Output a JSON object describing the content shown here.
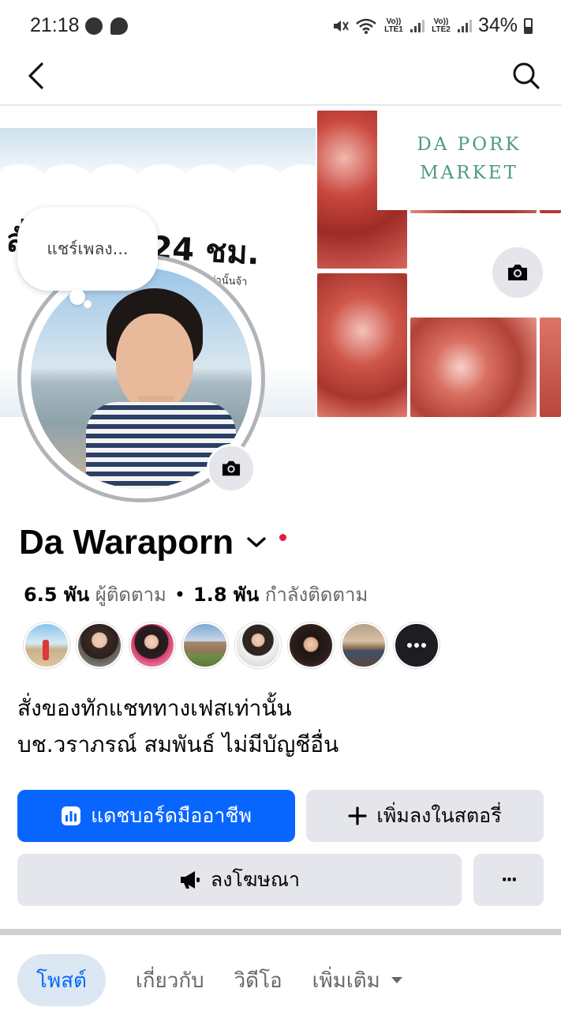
{
  "status_bar": {
    "time": "21:18",
    "battery": "34%",
    "sim1": "Vo)) LTE1",
    "sim2": "Vo)) LTE2"
  },
  "cover": {
    "headline": "สั่ง...แชท 24 ชม.",
    "subline": "...ธิ์ เท่านั้นจ้า",
    "brand_line1": "DA PORK",
    "brand_line2": "MARKET"
  },
  "note": {
    "text": "แชร์เพลง..."
  },
  "profile": {
    "name": "Da Waraporn",
    "followers_count": "6.5 พัน",
    "followers_label": "ผู้ติดตาม",
    "separator": "•",
    "following_count": "1.8 พัน",
    "following_label": "กำลังติดตาม",
    "bio_line1": "สั่งของทักแชททางเฟสเท่านั้น",
    "bio_line2": "บช.วราภรณ์ สมพันธ์ ไม่มีบัญชีอื่น"
  },
  "actions": {
    "dashboard": "แดชบอร์ดมืออาชีพ",
    "add_story": "เพิ่มลงในสตอรี่",
    "advertise": "ลงโฆษณา",
    "more": "···"
  },
  "tabs": [
    {
      "label": "โพสต์",
      "active": true
    },
    {
      "label": "เกี่ยวกับ",
      "active": false
    },
    {
      "label": "วิดีโอ",
      "active": false
    },
    {
      "label": "เพิ่มเติม",
      "active": false
    }
  ],
  "colors": {
    "primary": "#0866ff",
    "button_gray": "#e4e6eb",
    "active_tab_bg": "#dbe7f2",
    "online_dot": "#e41e3f"
  },
  "icons": [
    "back-arrow-icon",
    "search-icon",
    "camera-icon",
    "chevron-down-icon",
    "dashboard-chart-icon",
    "plus-icon",
    "megaphone-icon",
    "more-dots-icon",
    "caret-down-icon"
  ]
}
